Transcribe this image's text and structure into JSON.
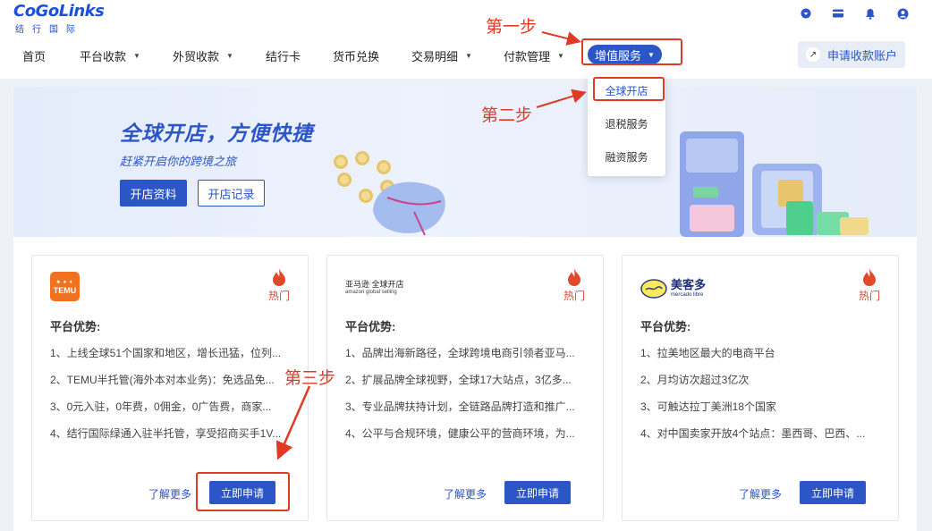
{
  "logo": {
    "brand": "CoGoLinks",
    "subtitle": "结行国际"
  },
  "top_icons": [
    "theme-icon",
    "card-icon",
    "bell-icon",
    "user-icon"
  ],
  "nav": {
    "items": [
      {
        "label": "首页",
        "dropdown": false
      },
      {
        "label": "平台收款",
        "dropdown": true
      },
      {
        "label": "外贸收款",
        "dropdown": true
      },
      {
        "label": "结行卡",
        "dropdown": false
      },
      {
        "label": "货币兑换",
        "dropdown": false
      },
      {
        "label": "交易明细",
        "dropdown": true
      },
      {
        "label": "付款管理",
        "dropdown": true
      }
    ],
    "active": {
      "label": "增值服务",
      "dropdown": true
    },
    "apply_account": "申请收款账户"
  },
  "dropdown": {
    "items": [
      {
        "label": "全球开店",
        "active": true
      },
      {
        "label": "退税服务",
        "active": false
      },
      {
        "label": "融资服务",
        "active": false
      }
    ]
  },
  "banner": {
    "title": "全球开店，方便快捷",
    "subtitle": "赶紧开启你的跨境之旅",
    "primary_button": "开店资料",
    "secondary_button": "开店记录"
  },
  "cards": [
    {
      "platform": "TEMU",
      "logo_text": "TEMU",
      "hot_label": "热门",
      "advantage_title": "平台优势:",
      "advantages": [
        "1、上线全球51个国家和地区，增长迅猛，位列...",
        "2、TEMU半托管(海外本对本业务)：免选品免...",
        "3、0元入驻，0年费，0佣金，0广告费，商家...",
        "4、结行国际绿通入驻半托管，享受招商买手1V..."
      ],
      "learn_more": "了解更多",
      "apply": "立即申请"
    },
    {
      "platform": "Amazon",
      "logo_text": "亚马逊 全球开店",
      "logo_sub": "amazon global selling",
      "hot_label": "热门",
      "advantage_title": "平台优势:",
      "advantages": [
        "1、品牌出海新路径，全球跨境电商引领者亚马...",
        "2、扩展品牌全球视野，全球17大站点，3亿多...",
        "3、专业品牌扶持计划，全链路品牌打造和推广...",
        "4、公平与合规环境，健康公平的营商环境，为..."
      ],
      "learn_more": "了解更多",
      "apply": "立即申请"
    },
    {
      "platform": "Mercado Libre",
      "logo_text": "美客多",
      "logo_sub": "mercado libre",
      "hot_label": "热门",
      "advantage_title": "平台优势:",
      "advantages": [
        "1、拉美地区最大的电商平台",
        "2、月均访次超过3亿次",
        "3、可触达拉丁美洲18个国家",
        "4、对中国卖家开放4个站点：墨西哥、巴西、..."
      ],
      "learn_more": "了解更多",
      "apply": "立即申请"
    }
  ],
  "annotations": {
    "step1": "第一步",
    "step2": "第二步",
    "step3": "第三步",
    "color": "#e03a25"
  },
  "colors": {
    "primary": "#2c55c6",
    "hot": "#e04a2c",
    "background": "#eef1f6"
  }
}
